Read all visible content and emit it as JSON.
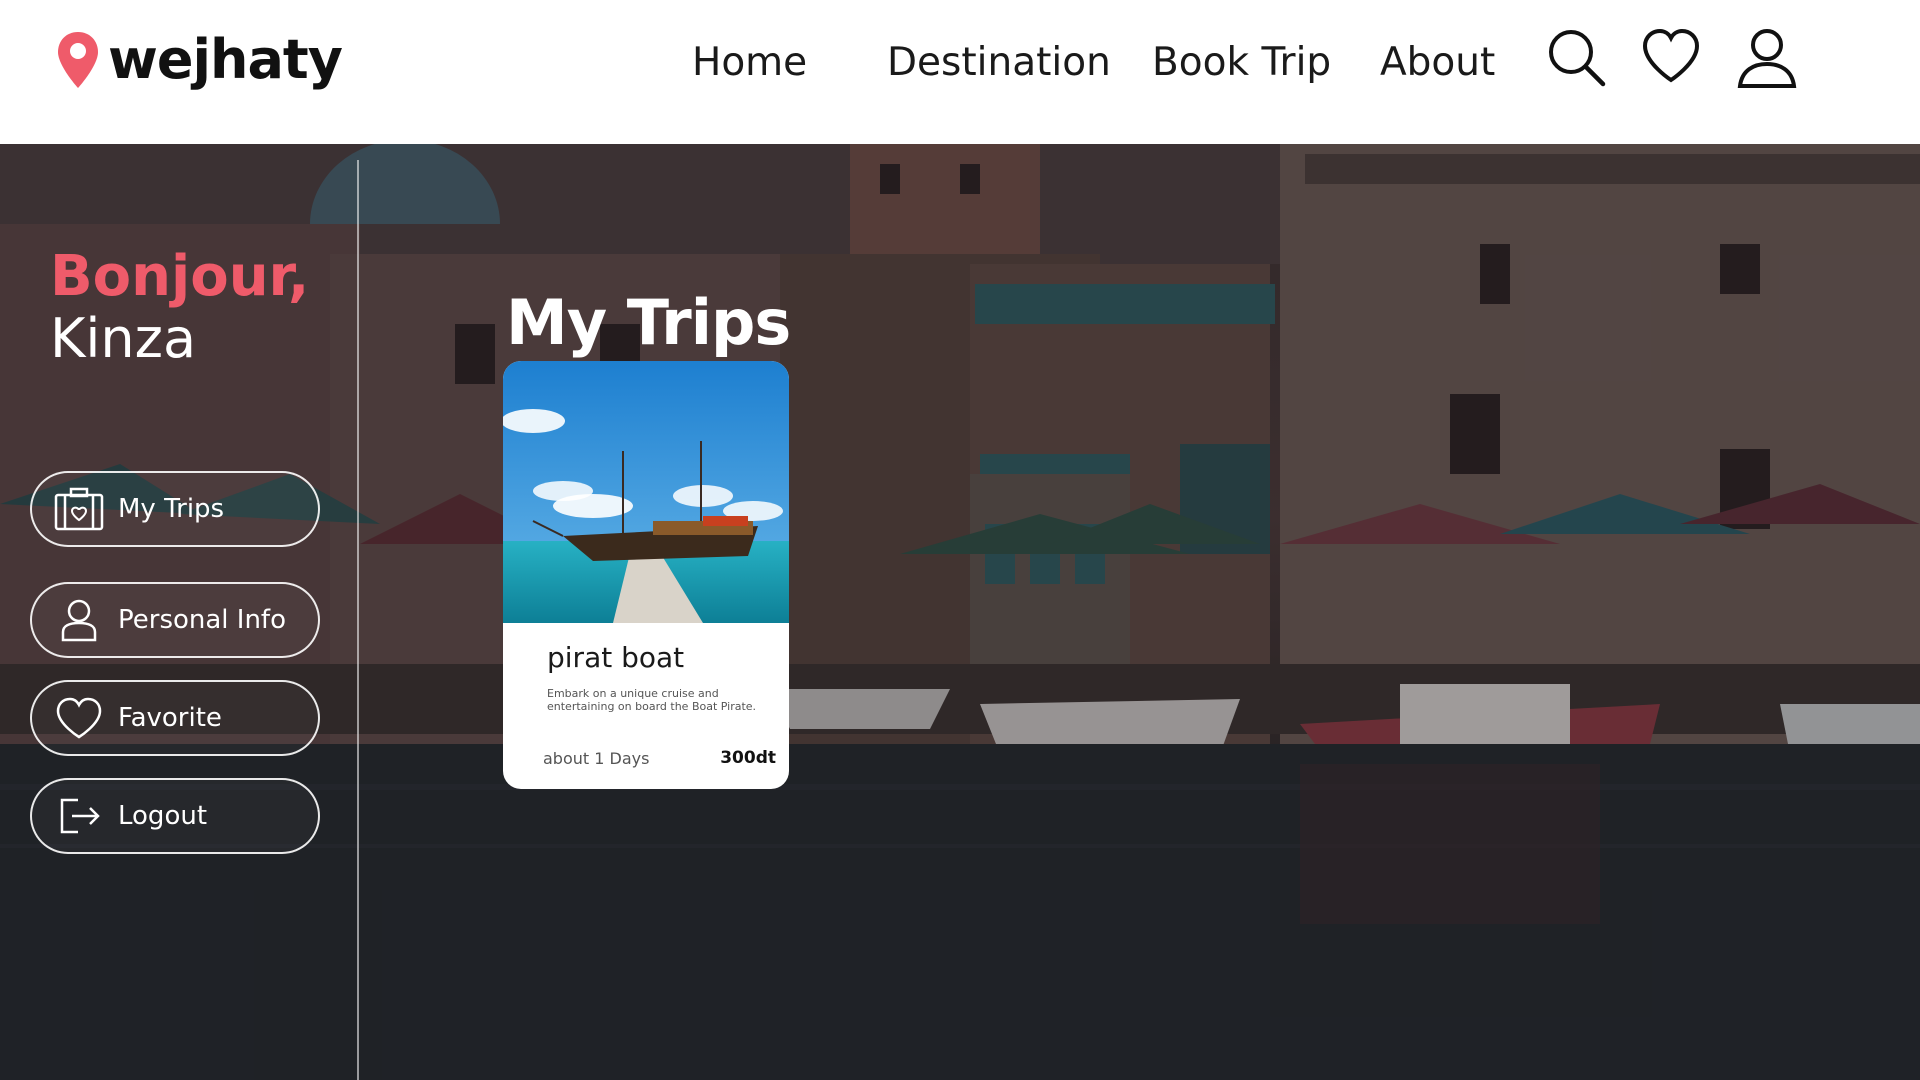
{
  "brand": {
    "name": "wejhaty",
    "pin_color": "#ef5b6a"
  },
  "nav": {
    "items": [
      {
        "label": "Home"
      },
      {
        "label": "Destination"
      },
      {
        "label": "Book Trip"
      },
      {
        "label": "About"
      }
    ],
    "icons": [
      "search-icon",
      "heart-icon",
      "user-icon"
    ]
  },
  "sidebar": {
    "greeting": "Bonjour,",
    "user_name": "Kinza",
    "items": [
      {
        "label": "My Trips",
        "icon": "luggage-icon"
      },
      {
        "label": "Personal Info",
        "icon": "user-icon"
      },
      {
        "label": "Favorite",
        "icon": "heart-icon"
      },
      {
        "label": "Logout",
        "icon": "logout-icon"
      }
    ]
  },
  "main": {
    "title": "My Trips",
    "trips": [
      {
        "title": "pirat boat",
        "description": "Embark on a unique cruise and entertaining on board the Boat Pirate.",
        "duration": "about 1 Days",
        "price": "300dt"
      }
    ]
  },
  "colors": {
    "accent": "#ef5b6a",
    "header_bg": "#ffffff",
    "text_dark": "#1a1a1a"
  }
}
